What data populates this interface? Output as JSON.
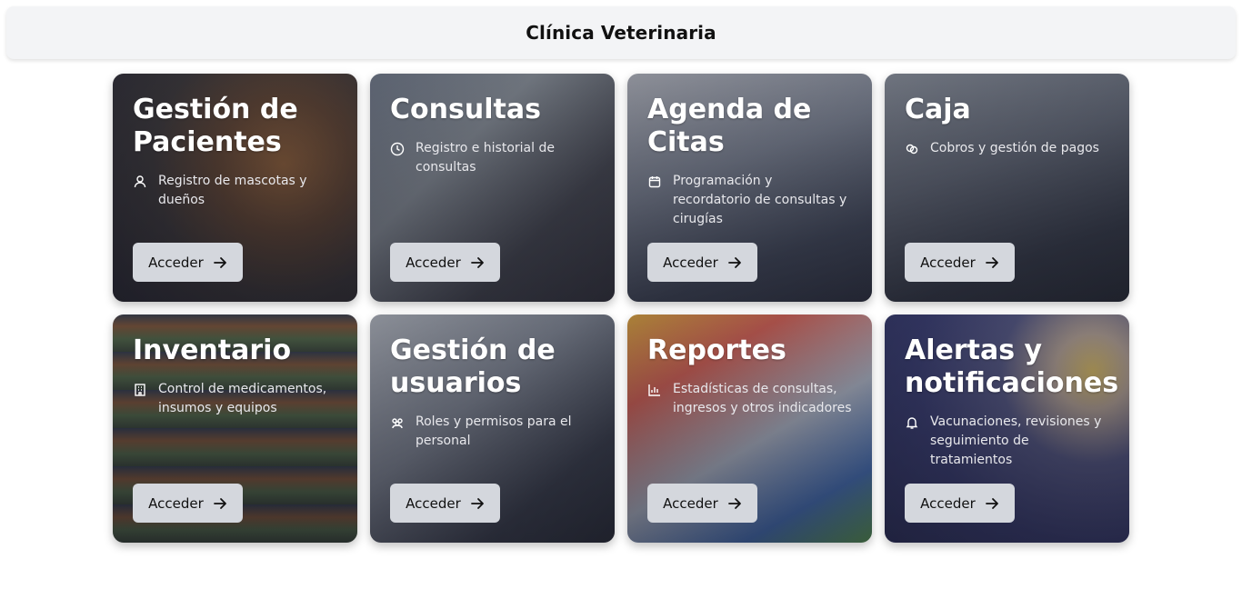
{
  "header": {
    "title": "Clínica Veterinaria"
  },
  "cards": [
    {
      "title": "Gestión de Pacientes",
      "description": "Registro de mascotas y dueños",
      "icon": "user-icon",
      "button": "Acceder"
    },
    {
      "title": "Consultas",
      "description": "Registro e historial de consultas",
      "icon": "clock-icon",
      "button": "Acceder"
    },
    {
      "title": "Agenda de Citas",
      "description": "Programación y recordatorio de consultas y cirugías",
      "icon": "calendar-icon",
      "button": "Acceder"
    },
    {
      "title": "Caja",
      "description": "Cobros y gestión de pagos",
      "icon": "coins-icon",
      "button": "Acceder"
    },
    {
      "title": "Inventario",
      "description": "Control de medicamentos, insumos y equipos",
      "icon": "building-icon",
      "button": "Acceder"
    },
    {
      "title": "Gestión de usuarios",
      "description": "Roles y permisos para el personal",
      "icon": "users-icon",
      "button": "Acceder"
    },
    {
      "title": "Reportes",
      "description": "Estadísticas de consultas, ingresos y otros indicadores",
      "icon": "bar-chart-icon",
      "button": "Acceder"
    },
    {
      "title": "Alertas y notificaciones",
      "description": "Vacunaciones, revisiones y seguimiento de tratamientos",
      "icon": "bell-icon",
      "button": "Acceder"
    }
  ]
}
